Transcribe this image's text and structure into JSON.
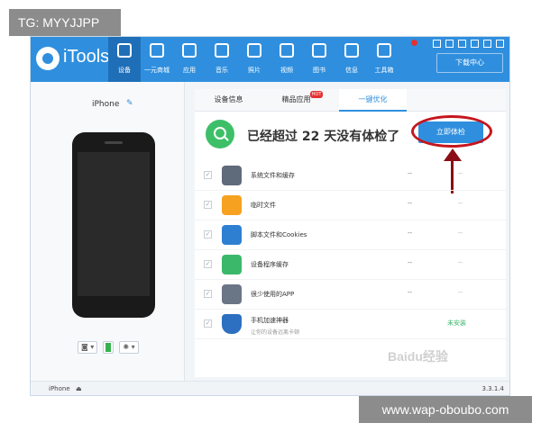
{
  "watermarks": {
    "top": "TG: MYYJJPP",
    "bottom": "www.wap-oboubo.com",
    "baidu": "Baidu经验"
  },
  "app": {
    "name": "iTools"
  },
  "nav": [
    {
      "label": "设备",
      "icon": "device-icon",
      "active": true
    },
    {
      "label": "一元商城",
      "icon": "cart-icon"
    },
    {
      "label": "应用",
      "icon": "apps-icon"
    },
    {
      "label": "音乐",
      "icon": "music-icon"
    },
    {
      "label": "照片",
      "icon": "photo-icon"
    },
    {
      "label": "视频",
      "icon": "video-icon"
    },
    {
      "label": "图书",
      "icon": "book-icon"
    },
    {
      "label": "信息",
      "icon": "contacts-icon"
    },
    {
      "label": "工具箱",
      "icon": "toolbox-icon"
    }
  ],
  "download_button": "下载中心",
  "sidebar": {
    "device_name": "iPhone"
  },
  "tabs": [
    {
      "label": "设备信息"
    },
    {
      "label": "精品应用",
      "badge": "HOT"
    },
    {
      "label": "一键优化",
      "active": true
    }
  ],
  "scan": {
    "message": "已经超过 22 天没有体检了",
    "button": "立即体检"
  },
  "items": [
    {
      "label": "系统文件和缓存",
      "dash1": "--",
      "dash2": "--",
      "icon_color": "#5f6b7a"
    },
    {
      "label": "临时文件",
      "dash1": "--",
      "dash2": "--",
      "icon_color": "#f6a120"
    },
    {
      "label": "脚本文件和Cookies",
      "dash1": "--",
      "dash2": "--",
      "icon_color": "#2e7fd1"
    },
    {
      "label": "设备程序缓存",
      "dash1": "--",
      "dash2": "--",
      "icon_color": "#3bb86a"
    },
    {
      "label": "很少使用的APP",
      "dash1": "--",
      "dash2": "--",
      "icon_color": "#6a7585"
    },
    {
      "label": "手机加速神器",
      "sublabel": "让你的设备远离卡顿",
      "status": "未安装",
      "icon_color": "#2d6fc0"
    }
  ],
  "statusbar": {
    "device": "iPhone",
    "version": "3.3.1.4"
  }
}
